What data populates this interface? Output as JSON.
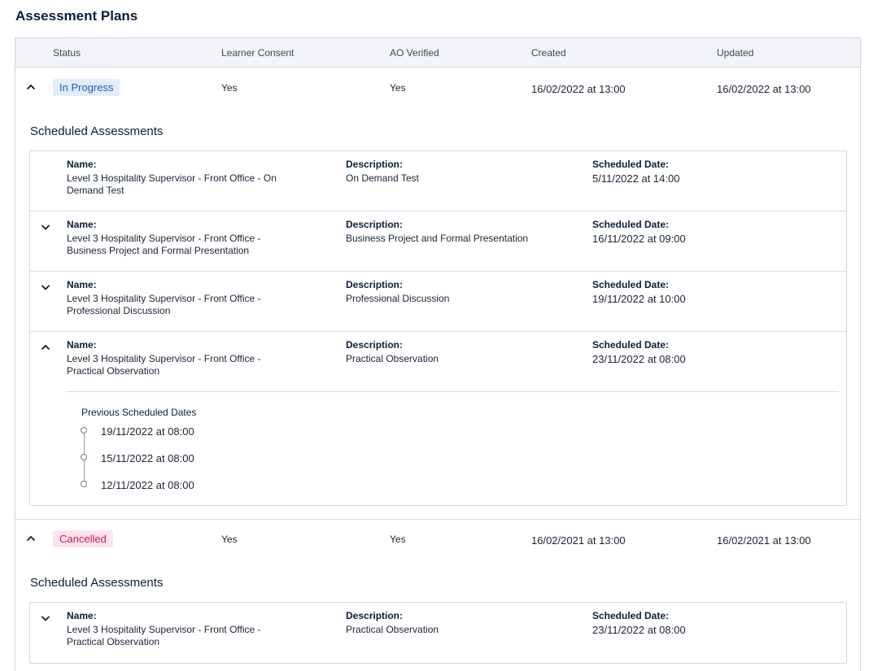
{
  "page": {
    "title": "Assessment Plans"
  },
  "columns": {
    "status": "Status",
    "consent": "Learner Consent",
    "ao": "AO Verified",
    "created": "Created",
    "updated": "Updated"
  },
  "plans": [
    {
      "status": "In Progress",
      "consent": "Yes",
      "ao": "Yes",
      "created": "16/02/2022 at 13:00",
      "updated": "16/02/2022 at 13:00",
      "scheduled_title": "Scheduled Assessments",
      "items": [
        {
          "name_label": "Name:",
          "name": "Level 3 Hospitality Supervisor - Front Office - On Demand Test",
          "desc_label": "Description:",
          "desc": "On Demand Test",
          "date_label": "Scheduled Date:",
          "date": "5/11/2022 at 14:00"
        },
        {
          "name_label": "Name:",
          "name": "Level 3 Hospitality Supervisor - Front Office - Business Project and Formal Presentation",
          "desc_label": "Description:",
          "desc": "Business Project and Formal Presentation",
          "date_label": "Scheduled Date:",
          "date": "16/11/2022 at 09:00"
        },
        {
          "name_label": "Name:",
          "name": "Level 3 Hospitality Supervisor - Front Office - Professional Discussion",
          "desc_label": "Description:",
          "desc": "Professional Discussion",
          "date_label": "Scheduled Date:",
          "date": "19/11/2022 at 10:00"
        },
        {
          "name_label": "Name:",
          "name": "Level 3 Hospitality Supervisor - Front Office - Practical Observation",
          "desc_label": "Description:",
          "desc": "Practical Observation",
          "date_label": "Scheduled Date:",
          "date": "23/11/2022 at 08:00",
          "previous_title": "Previous Scheduled Dates",
          "previous": [
            "19/11/2022 at 08:00",
            "15/11/2022 at 08:00",
            "12/11/2022 at 08:00"
          ]
        }
      ]
    },
    {
      "status": "Cancelled",
      "consent": "Yes",
      "ao": "Yes",
      "created": "16/02/2021 at 13:00",
      "updated": "16/02/2021 at 13:00",
      "scheduled_title": "Scheduled Assessments",
      "items": [
        {
          "name_label": "Name:",
          "name": "Level 3 Hospitality Supervisor - Front Office - Practical Observation",
          "desc_label": "Description:",
          "desc": "Practical Observation",
          "date_label": "Scheduled Date:",
          "date": "23/11/2022 at 08:00"
        }
      ]
    }
  ],
  "colors": {
    "in_progress_bg": "#e3ecfa",
    "in_progress_text": "#1f5fbf",
    "cancelled_bg": "#fde3ec",
    "cancelled_text": "#cc1b5a"
  },
  "icons": {
    "collapse": "chevron-up-icon",
    "expand": "chevron-down-icon"
  }
}
